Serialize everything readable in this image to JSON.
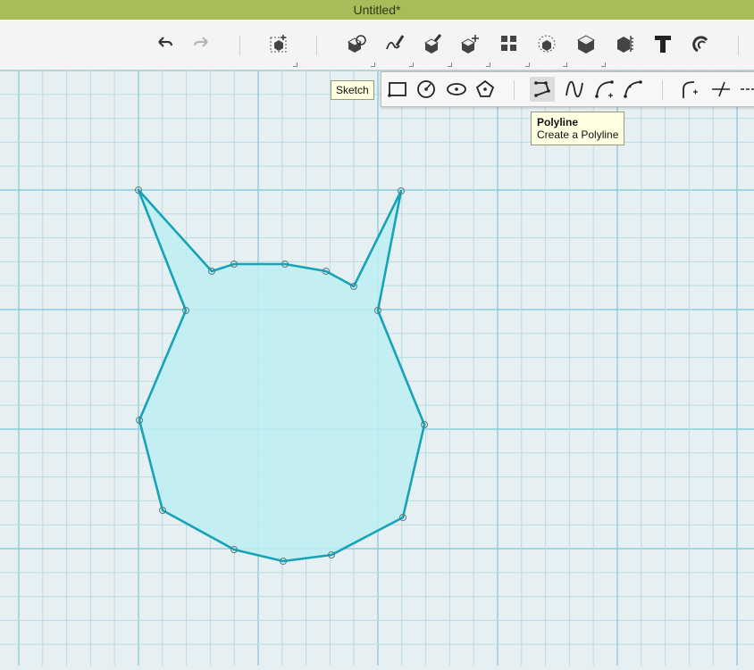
{
  "window": {
    "title": "Untitled*"
  },
  "toolbar": {
    "items": [
      {
        "name": "undo-icon"
      },
      {
        "name": "redo-icon"
      },
      {
        "name": "primitives-icon"
      },
      {
        "name": "sketch-icon"
      },
      {
        "name": "construct-icon"
      },
      {
        "name": "modify-icon"
      },
      {
        "name": "pattern-icon"
      },
      {
        "name": "group-icon"
      },
      {
        "name": "combine-icon"
      },
      {
        "name": "measure-icon"
      },
      {
        "name": "text-icon"
      },
      {
        "name": "snap-icon"
      }
    ]
  },
  "sketch_tooltip": {
    "label": "Sketch"
  },
  "sketch_toolbar": {
    "items": [
      {
        "name": "rectangle-icon"
      },
      {
        "name": "circle-icon"
      },
      {
        "name": "ellipse-icon"
      },
      {
        "name": "polygon-icon"
      },
      {
        "name": "polyline-icon"
      },
      {
        "name": "spline-icon"
      },
      {
        "name": "two-point-arc-icon"
      },
      {
        "name": "three-point-arc-icon"
      },
      {
        "name": "fillet-icon"
      },
      {
        "name": "trim-icon"
      },
      {
        "name": "extend-icon"
      }
    ],
    "active": "polyline-icon"
  },
  "polyline_tooltip": {
    "title": "Polyline",
    "description": "Create a Polyline"
  },
  "colors": {
    "titlebar": "#a8bc5a",
    "grid_minor": "#b9dbe4",
    "grid_major": "#7ec7d8",
    "shape_fill": "#bdeef2",
    "shape_stroke": "#16a3b8"
  }
}
